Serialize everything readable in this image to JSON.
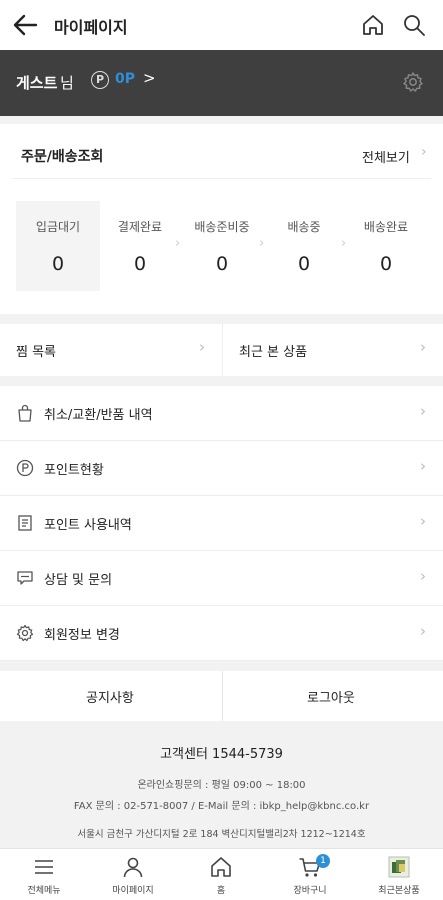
{
  "header": {
    "title": "마이페이지"
  },
  "user": {
    "name": "게스트",
    "suffix": "님",
    "point_icon": "P",
    "points": "0P",
    "arrow": ">"
  },
  "orders": {
    "title": "주문/배송조회",
    "view_all": "전체보기",
    "stages": [
      {
        "label": "입금대기",
        "count": "0"
      },
      {
        "label": "결제완료",
        "count": "0"
      },
      {
        "label": "배송준비중",
        "count": "0"
      },
      {
        "label": "배송중",
        "count": "0"
      },
      {
        "label": "배송완료",
        "count": "0"
      }
    ]
  },
  "quick_links": [
    {
      "label": "찜 목록"
    },
    {
      "label": "최근 본 상품"
    }
  ],
  "menu": [
    {
      "label": "취소/교환/반품 내역",
      "icon": "shopping-bag-icon"
    },
    {
      "label": "포인트현황",
      "icon": "point-icon"
    },
    {
      "label": "포인트 사용내역",
      "icon": "document-icon"
    },
    {
      "label": "상담 및 문의",
      "icon": "chat-icon"
    },
    {
      "label": "회원정보 변경",
      "icon": "gear-icon"
    }
  ],
  "bottom_links": {
    "notice": "공지사항",
    "logout": "로그아웃"
  },
  "footer": {
    "customer_center": "고객센터 1544-5739",
    "line1": "온라인쇼핑문의 : 평일 09:00 ~ 18:00",
    "line2": "FAX 문의 : 02-571-8007 / E-Mail 문의 : ibkp_help@kbnc.co.kr",
    "line3": "서울시 금천구 가산디지털 2로 184 벽산디지털밸리2차 1212~1214호"
  },
  "tabbar": {
    "items": [
      {
        "label": "전체메뉴",
        "icon": "hamburger-icon"
      },
      {
        "label": "마이페이지",
        "icon": "person-icon"
      },
      {
        "label": "홈",
        "icon": "home-icon"
      },
      {
        "label": "장바구니",
        "icon": "cart-icon",
        "badge": "1"
      },
      {
        "label": "최근본상품",
        "icon": "recent-product-thumbnail"
      }
    ]
  },
  "colors": {
    "accent": "#2e8fd6",
    "user_bar": "#3f3f3f"
  }
}
